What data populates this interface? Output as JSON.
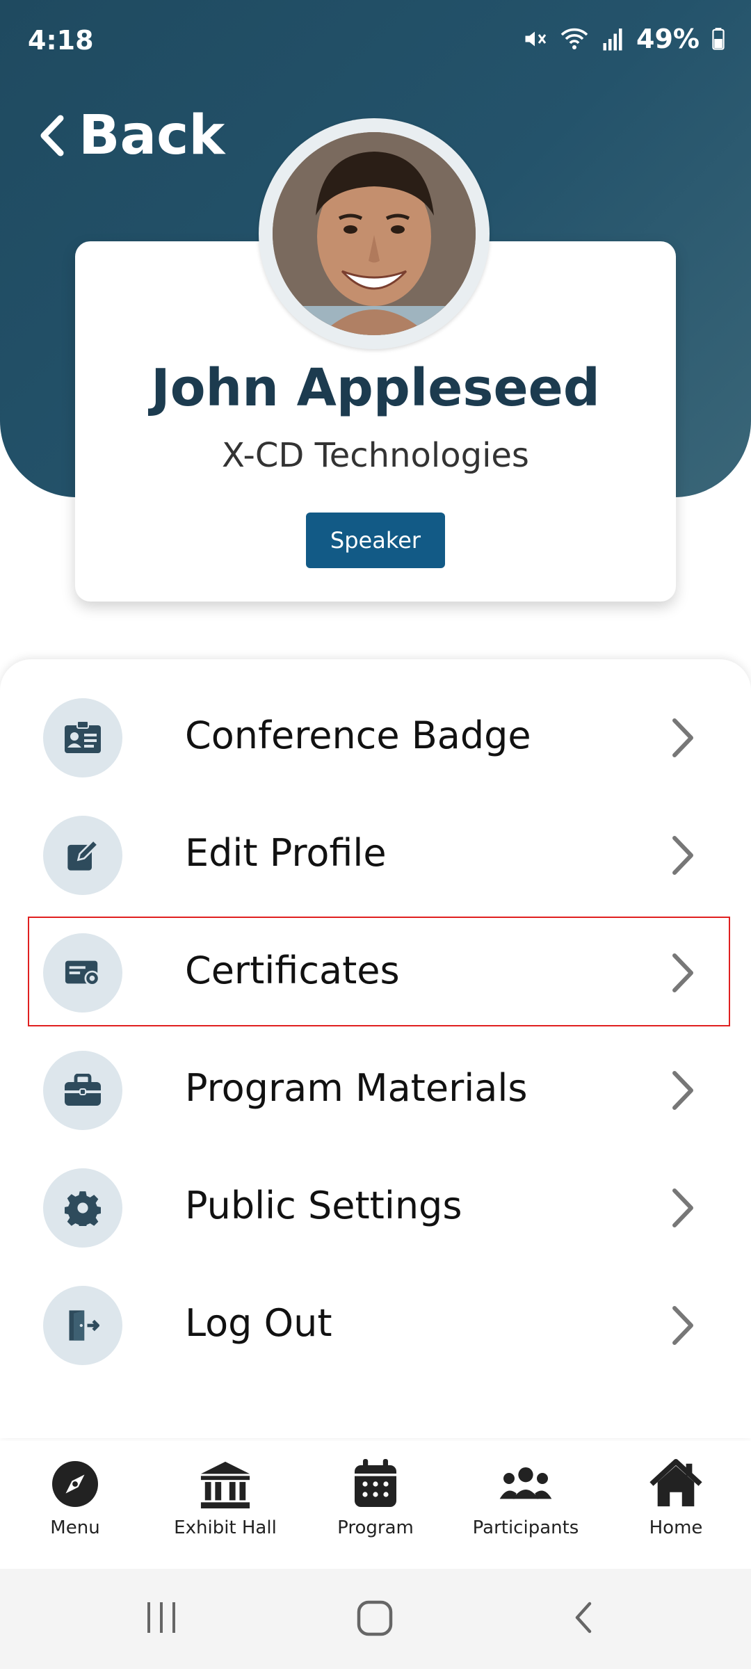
{
  "status_bar": {
    "time": "4:18",
    "battery": "49%"
  },
  "header": {
    "back_label": "Back"
  },
  "profile": {
    "name": "John Appleseed",
    "company": "X-CD Technologies",
    "role": "Speaker"
  },
  "menu": {
    "items": [
      {
        "label": "Conference Badge",
        "icon": "id-badge-icon"
      },
      {
        "label": "Edit Profile",
        "icon": "edit-icon"
      },
      {
        "label": "Certificates",
        "icon": "certificate-icon"
      },
      {
        "label": "Program Materials",
        "icon": "briefcase-icon"
      },
      {
        "label": "Public Settings",
        "icon": "gear-icon"
      },
      {
        "label": "Log Out",
        "icon": "logout-icon"
      }
    ]
  },
  "bottom_nav": {
    "items": [
      {
        "label": "Menu",
        "icon": "compass-icon"
      },
      {
        "label": "Exhibit Hall",
        "icon": "building-icon"
      },
      {
        "label": "Program",
        "icon": "calendar-icon"
      },
      {
        "label": "Participants",
        "icon": "people-icon"
      },
      {
        "label": "Home",
        "icon": "home-icon"
      }
    ]
  },
  "colors": {
    "header_bg": "#24536b",
    "accent": "#125a86",
    "name_text": "#1c3b4f",
    "icon_circle": "#dde6ec",
    "icon_fill": "#2e4b5c",
    "highlight": "#e02020"
  }
}
